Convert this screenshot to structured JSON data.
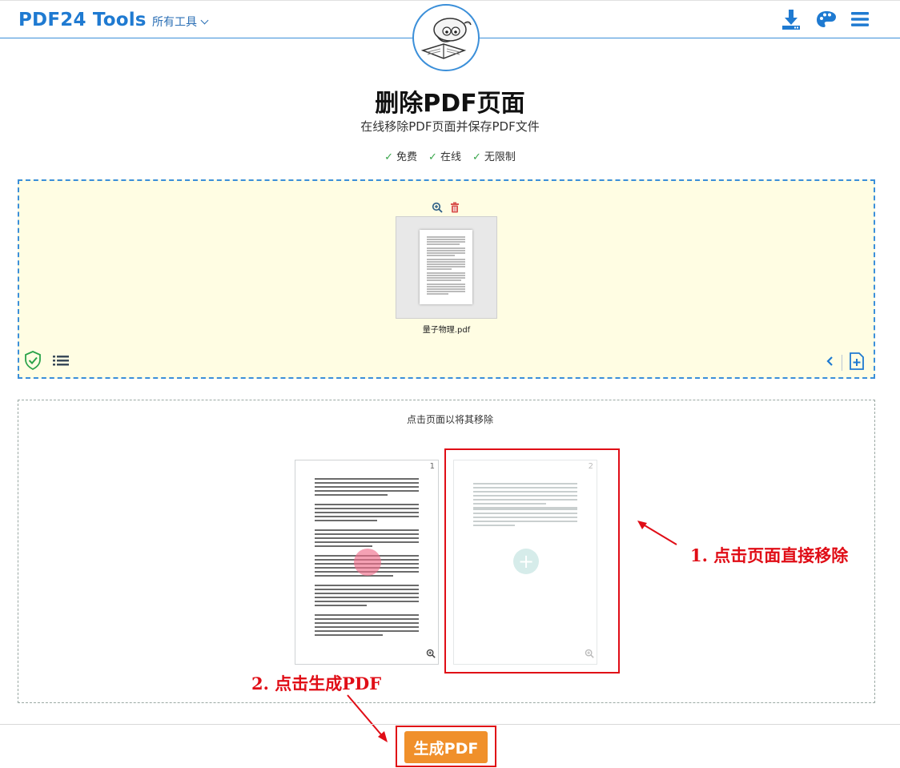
{
  "header": {
    "brand": "PDF24 Tools",
    "tools_menu_label": "所有工具",
    "icons": [
      "download-icon",
      "palette-icon",
      "menu-icon"
    ],
    "accent_color": "#1f7ad1"
  },
  "hero": {
    "title": "删除PDF页面",
    "subtitle": "在线移除PDF页面并保存PDF文件",
    "features": [
      "免费",
      "在线",
      "无限制"
    ]
  },
  "file": {
    "name": "量子物理.pdf",
    "actions": [
      "zoom-in-icon",
      "trash-icon"
    ]
  },
  "pages": {
    "hint": "点击页面以将其移除",
    "items": [
      {
        "number": "1",
        "removed": false
      },
      {
        "number": "2",
        "removed": true
      }
    ]
  },
  "annotations": {
    "step1": "1. 点击页面直接移除",
    "step2": "2. 点击生成PDF"
  },
  "action": {
    "generate_label": "生成PDF",
    "button_color": "#f0902b"
  }
}
